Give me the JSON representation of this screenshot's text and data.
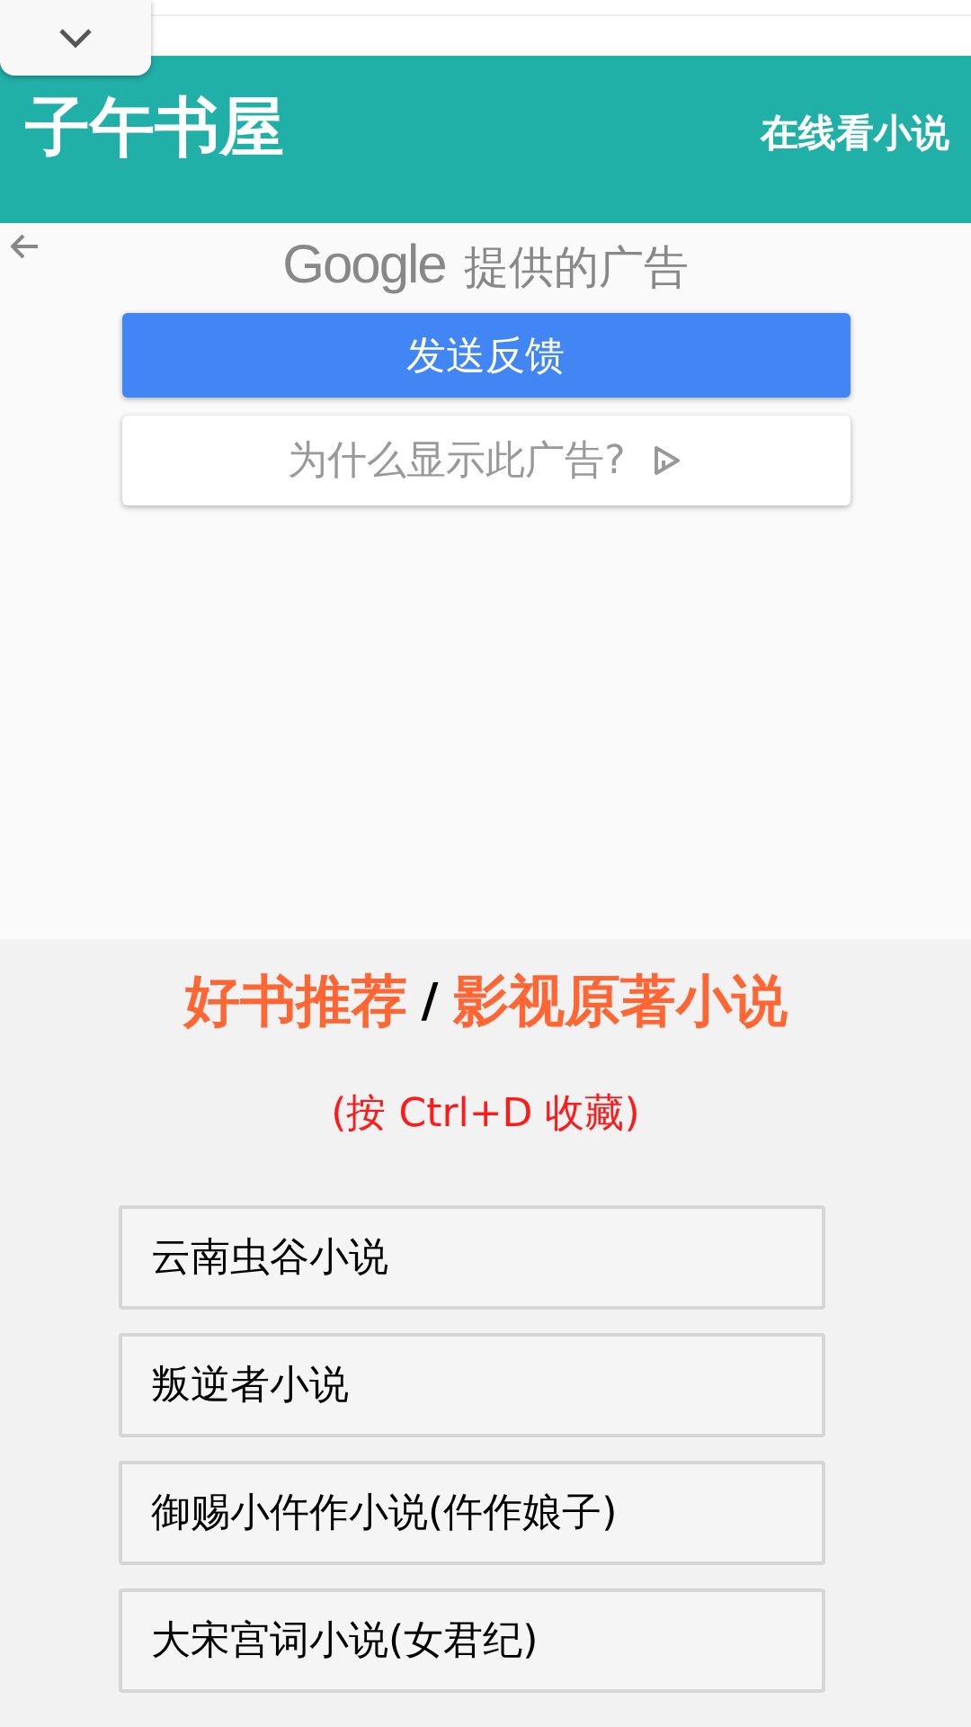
{
  "header": {
    "title": "子午书屋",
    "tagline": "在线看小说"
  },
  "ad": {
    "brand": "Google",
    "label": "提供的广告",
    "feedback_button": "发送反馈",
    "why_button": "为什么显示此广告?"
  },
  "section": {
    "heading_left": "好书推荐",
    "separator": "/",
    "heading_right": "影视原著小说",
    "hint": "(按 Ctrl+D 收藏)"
  },
  "books": [
    {
      "title": "云南虫谷小说"
    },
    {
      "title": "叛逆者小说"
    },
    {
      "title": "御赐小仵作小说(仵作娘子)"
    },
    {
      "title": "大宋宫词小说(女君纪)"
    }
  ]
}
